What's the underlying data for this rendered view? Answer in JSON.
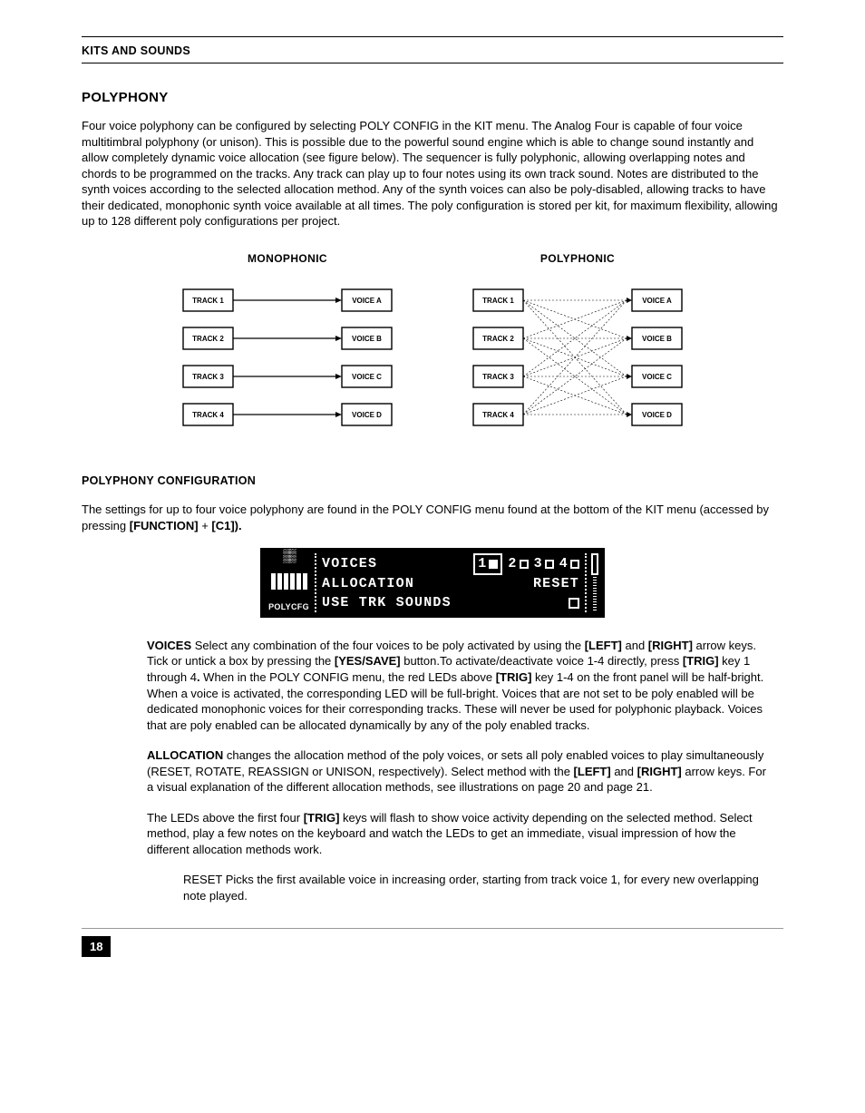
{
  "header": {
    "section": "KITS AND SOUNDS"
  },
  "h1": "POLYPHONY",
  "intro": "Four voice polyphony can be configured by selecting POLY CONFIG in the KIT menu. The Analog Four is capable of four voice multitimbral polyphony (or unison). This is possible due to the powerful sound engine which is able to change sound instantly and allow completely dynamic voice allocation (see figure below). The sequencer is fully polyphonic, allowing overlapping notes and chords to be programmed on the tracks. Any track can play up to four notes using its own track sound. Notes are distributed to the synth voices according to the selected allocation method. Any of the synth voices can also be poly-disabled, allowing tracks to have their dedicated, monophonic synth voice available at all times. The poly configuration is stored per kit, for maximum flexibility, allowing up to 128 different poly configurations per project.",
  "diagrams": {
    "mono": {
      "title": "MONOPHONIC",
      "tracks": [
        "TRACK 1",
        "TRACK 2",
        "TRACK 3",
        "TRACK 4"
      ],
      "voices": [
        "VOICE A",
        "VOICE B",
        "VOICE C",
        "VOICE D"
      ]
    },
    "poly": {
      "title": "POLYPHONIC",
      "tracks": [
        "TRACK 1",
        "TRACK 2",
        "TRACK 3",
        "TRACK 4"
      ],
      "voices": [
        "VOICE A",
        "VOICE B",
        "VOICE C",
        "VOICE D"
      ]
    }
  },
  "config_heading": "POLYPHONY CONFIGURATION",
  "config_intro_parts": {
    "p1": "The settings for up to four voice polyphony are found in the POLY CONFIG menu found at the bottom of the KIT menu (accessed by pressing ",
    "b1": "[FUNCTION]",
    "mid": " + ",
    "b2": "[C1]).",
    "p2": ""
  },
  "lcd": {
    "side_label": "POLYCFG",
    "line1_label": "VOICES",
    "voices": [
      "1",
      "2",
      "3",
      "4"
    ],
    "line2_label": "ALLOCATION",
    "line2_value": "RESET",
    "line3_label": "USE TRK SOUNDS"
  },
  "voices_para": {
    "b_voices": "VOICES",
    "t1": " Select any combination of the four voices to be poly activated by using the ",
    "b_left": "[LEFT]",
    "t2": " and ",
    "b_right": "[RIGHT]",
    "t3": " arrow keys. Tick or untick a box by pressing the ",
    "b_yes": "[YES/SAVE]",
    "t4": " button.To activate/deactivate voice 1-4 directly, press ",
    "b_trig1": "[TRIG]",
    "t5": " key 1 through 4",
    "b_dot": ".",
    "t6": " When in the POLY CONFIG menu, the red LEDs above ",
    "b_trig2": "[TRIG]",
    "t7": " key 1-4 on the front panel will be half-bright. When a voice is activated, the corresponding LED will be full-bright. Voices that are not set to be poly enabled will be dedicated monophonic voices for their corresponding tracks. These will never be used for polyphonic playback. Voices that are poly enabled can be allocated dynamically by any of the poly enabled tracks."
  },
  "alloc_para": {
    "b_alloc": "ALLOCATION",
    "t1": " changes the allocation method of the poly voices, or sets all poly enabled voices to play simultaneously (RESET, ROTATE, REASSIGN or UNISON, respectively). Select method with the ",
    "b_left": "[LEFT]",
    "t2": " and ",
    "b_right": "[RIGHT]",
    "t3": " arrow keys. For a visual explanation of the different allocation methods, see illustrations on page 20 and page 21."
  },
  "led_para": {
    "t1": "The LEDs above the first four ",
    "b_trig": "[TRIG]",
    "t2": " keys will flash to show voice activity depending on the selected method. Select method, play a few notes on the keyboard and watch the LEDs to get an immediate, visual impression of how the different allocation methods work."
  },
  "reset_para": "RESET Picks the first available voice in increasing order, starting from track voice 1, for every new overlapping note played.",
  "page_number": "18"
}
